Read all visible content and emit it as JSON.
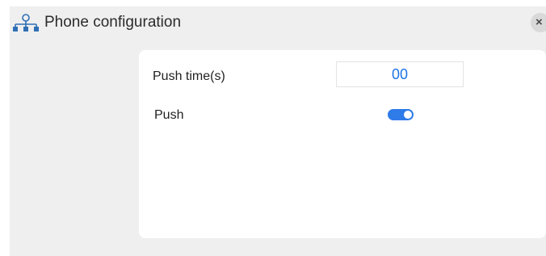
{
  "header": {
    "title": "Phone configuration",
    "icon": "network-icon",
    "close_label": "×"
  },
  "form": {
    "push_time": {
      "label": "Push time(s)",
      "value": "00"
    },
    "push": {
      "label": "Push",
      "enabled": true
    }
  },
  "colors": {
    "accent": "#2f7be8",
    "value_text": "#1f73e6",
    "background": "#efefef",
    "panel": "#ffffff"
  }
}
